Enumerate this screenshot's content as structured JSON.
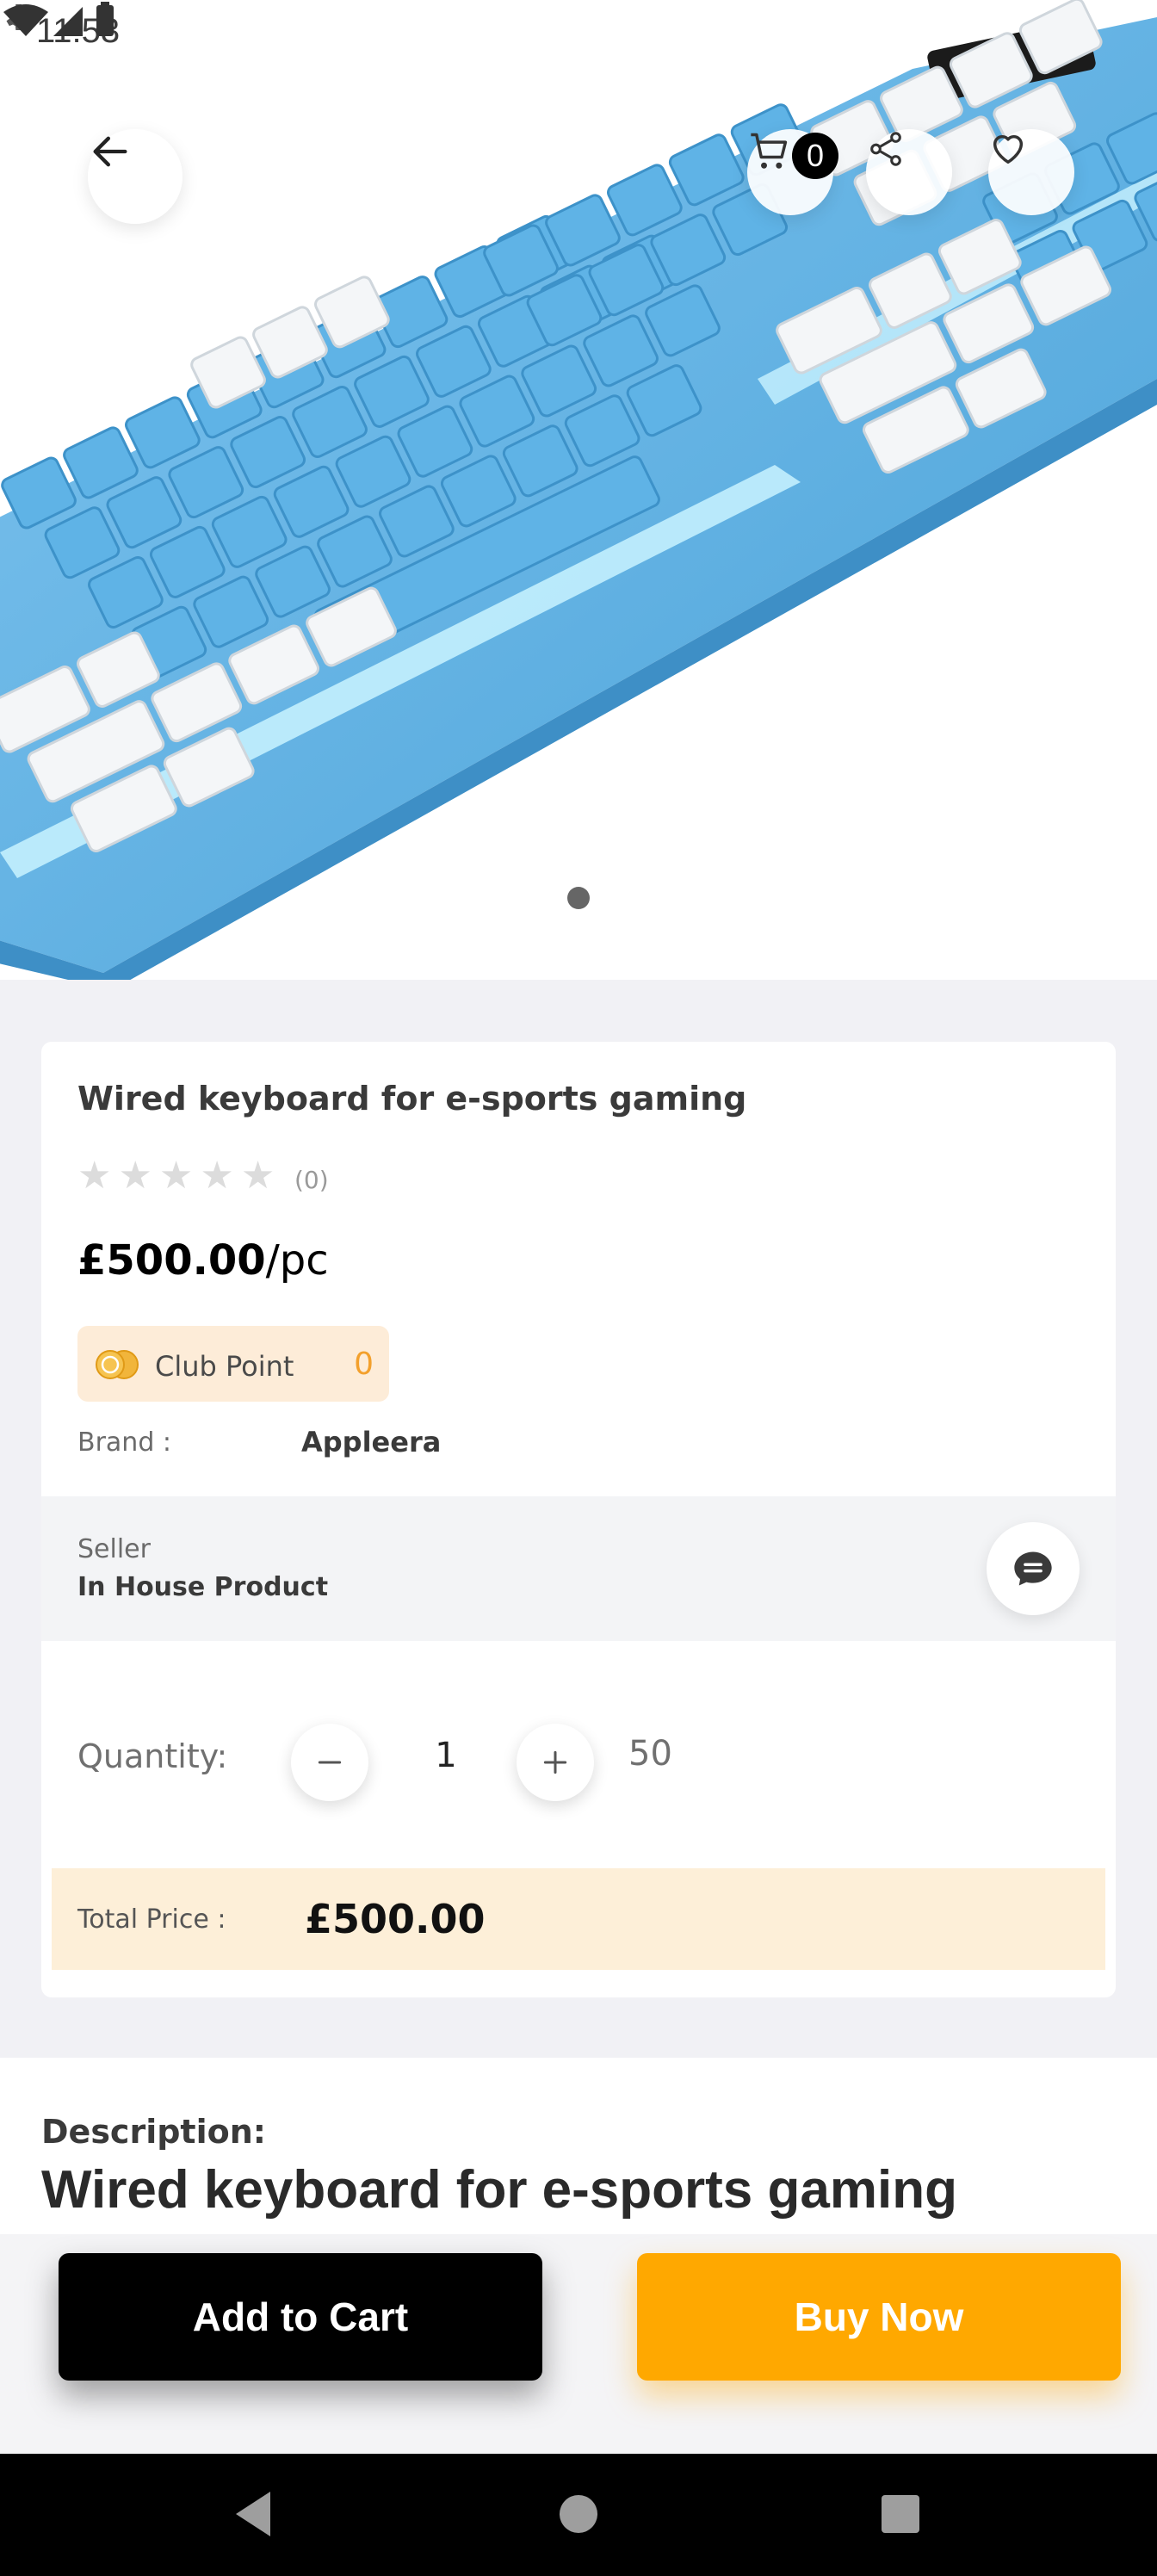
{
  "status_bar": {
    "time": "11:53"
  },
  "header": {
    "cart_count": "0"
  },
  "product": {
    "title": "Wired keyboard for e-sports gaming",
    "rating_count": "(0)",
    "rating_value": 0,
    "rating_max": 5,
    "price": "£500.00",
    "unit": "/pc",
    "club_point_label": "Club Point",
    "club_point_value": "0",
    "brand_label": "Brand :",
    "brand_value": "Appleera",
    "seller_label": "Seller",
    "seller_value": "In House Product",
    "quantity_label": "Quantity:",
    "quantity_value": "1",
    "stock": "50",
    "total_label": "Total Price :",
    "total_value": "£500.00"
  },
  "description": {
    "label": "Description:",
    "text": "Wired keyboard for e-sports gaming"
  },
  "actions": {
    "add_to_cart": "Add to Cart",
    "buy_now": "Buy Now"
  },
  "colors": {
    "accent": "#ffa800",
    "club_bg": "#fdecd8",
    "total_bg": "#fdefd8"
  }
}
